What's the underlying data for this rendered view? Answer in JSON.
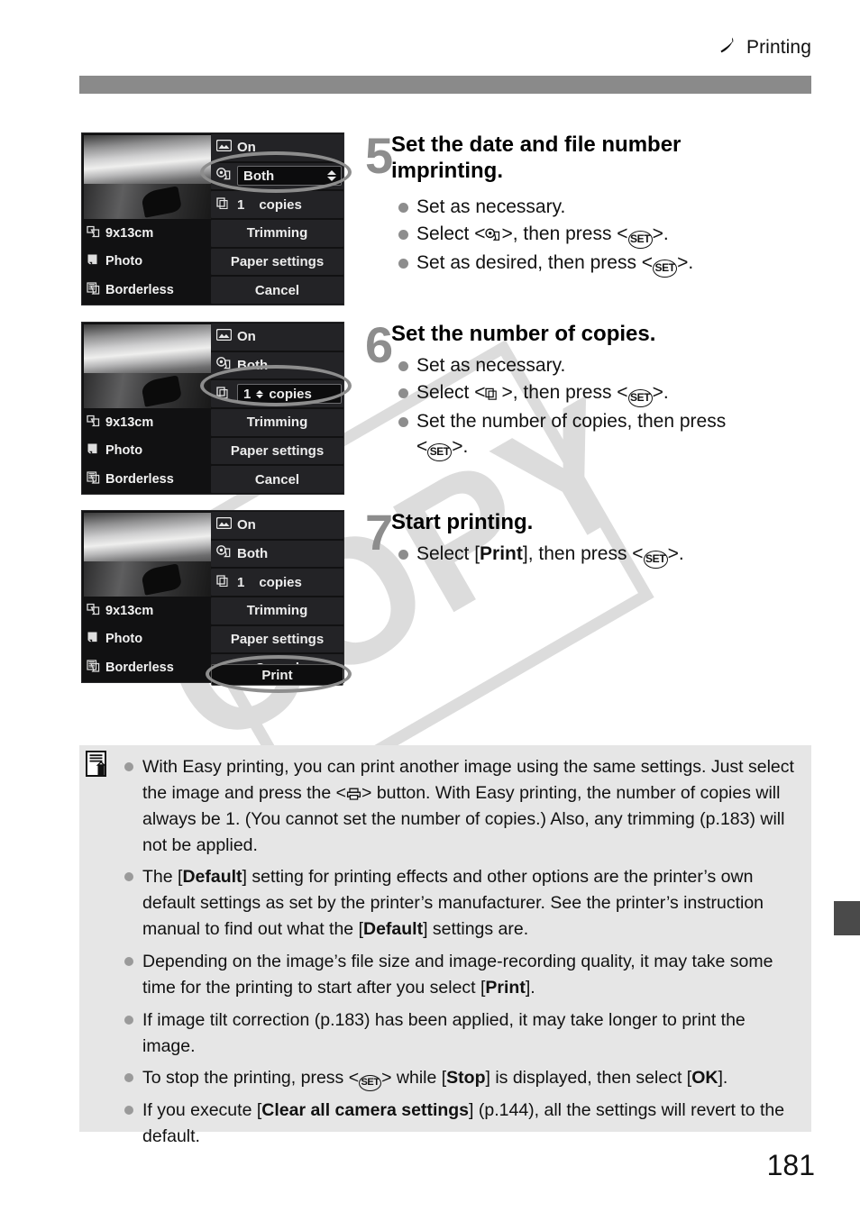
{
  "header": {
    "section_label": "Printing",
    "icon": "printer-icon"
  },
  "watermark": {
    "text": "COPY"
  },
  "folio": {
    "page_number": "181"
  },
  "lcd_common": {
    "rows_right": [
      {
        "icon": "image-effect-icon",
        "label": "On"
      },
      {
        "icon": "date-imprint-icon",
        "label": "Both"
      },
      {
        "icon": "copies-icon",
        "label_value": "1",
        "label_unit": "copies"
      }
    ],
    "menu_items": [
      "Trimming",
      "Paper settings",
      "Cancel",
      "Print"
    ],
    "rows_left": [
      {
        "icon": "paper-size-icon",
        "label": "9x13cm"
      },
      {
        "icon": "paper-type-icon",
        "label": "Photo"
      },
      {
        "icon": "page-layout-icon",
        "label": "Borderless"
      }
    ]
  },
  "steps": [
    {
      "number": "5",
      "title": "Set the date and file number imprinting.",
      "bullets": [
        {
          "parts": [
            {
              "t": "Set as necessary."
            }
          ]
        },
        {
          "parts": [
            {
              "t": "Select <"
            },
            {
              "icon": "date-imprint-icon"
            },
            {
              "t": ">, then press <"
            },
            {
              "key": "SET"
            },
            {
              "t": ">."
            }
          ]
        },
        {
          "parts": [
            {
              "t": "Set as desired, then press <"
            },
            {
              "key": "SET"
            },
            {
              "t": ">."
            }
          ]
        }
      ],
      "highlight": "date-imprint-row"
    },
    {
      "number": "6",
      "title": "Set the number of copies.",
      "bullets": [
        {
          "parts": [
            {
              "t": "Set as necessary."
            }
          ]
        },
        {
          "parts": [
            {
              "t": "Select <"
            },
            {
              "icon": "copies-icon"
            },
            {
              "t": ">, then press <"
            },
            {
              "key": "SET"
            },
            {
              "t": ">."
            }
          ]
        },
        {
          "parts": [
            {
              "t": "Set the number of copies, then press <"
            },
            {
              "key": "SET"
            },
            {
              "t": ">."
            }
          ]
        }
      ],
      "highlight": "copies-row"
    },
    {
      "number": "7",
      "title": "Start printing.",
      "bullets": [
        {
          "parts": [
            {
              "t": "Select ["
            },
            {
              "b": "Print"
            },
            {
              "t": "], then press <"
            },
            {
              "key": "SET"
            },
            {
              "t": ">."
            }
          ]
        }
      ],
      "highlight": "print-button"
    }
  ],
  "note": {
    "icon": "note-pencil-icon",
    "bullets": [
      {
        "parts": [
          {
            "t": "With Easy printing, you can print another image using the same settings. Just select the image and press the <"
          },
          {
            "icon": "print-button-icon"
          },
          {
            "t": "> button. With Easy printing, the number of copies will always be 1. (You cannot set the number of copies.) Also, any trimming (p.183) will not be applied."
          }
        ]
      },
      {
        "parts": [
          {
            "t": "The ["
          },
          {
            "b": "Default"
          },
          {
            "t": "] setting for printing effects and other options are the printer’s own default settings as set by the printer’s manufacturer. See the printer’s instruction manual to find out what the ["
          },
          {
            "b": "Default"
          },
          {
            "t": "] settings are."
          }
        ]
      },
      {
        "parts": [
          {
            "t": "Depending on the image’s file size and image-recording quality, it may take some time for the printing to start after you select ["
          },
          {
            "b": "Print"
          },
          {
            "t": "]."
          }
        ]
      },
      {
        "parts": [
          {
            "t": "If image tilt correction (p.183) has been applied, it may take longer to print the image."
          }
        ]
      },
      {
        "parts": [
          {
            "t": "To stop the printing, press <"
          },
          {
            "key": "SET"
          },
          {
            "t": "> while ["
          },
          {
            "b": "Stop"
          },
          {
            "t": "] is displayed, then select ["
          },
          {
            "b": "OK"
          },
          {
            "t": "]."
          }
        ]
      },
      {
        "parts": [
          {
            "t": "If you execute ["
          },
          {
            "b": "Clear all camera settings"
          },
          {
            "t": "] (p.144), all the settings will revert to the default."
          }
        ]
      }
    ]
  },
  "colors": {
    "grey_bar": "#8a8a8a",
    "note_bg": "#e6e6e6",
    "watermark": "#dcdcdc",
    "accent_grey": "#8d8d8d",
    "side_tab": "#4a4a4a",
    "lcd_bg": "#111112"
  }
}
